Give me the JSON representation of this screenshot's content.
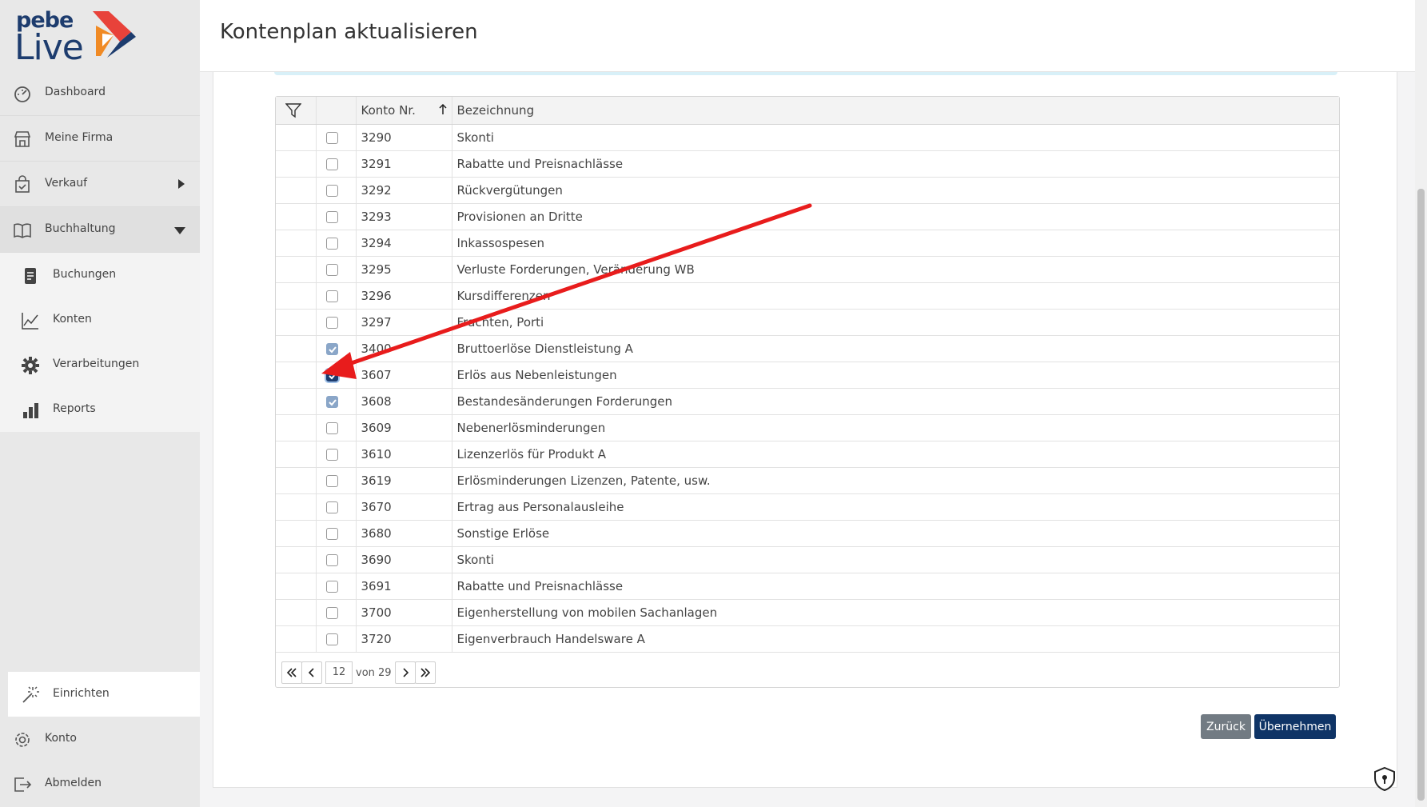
{
  "brand": {
    "top": "pebe",
    "bottom": "Live"
  },
  "header": {
    "title": "Kontenplan aktualisieren"
  },
  "sidebar": {
    "items": [
      {
        "label": "Dashboard",
        "icon": "dashboard-icon"
      },
      {
        "label": "Meine Firma",
        "icon": "store-icon"
      },
      {
        "label": "Verkauf",
        "icon": "shopping-bag-icon"
      },
      {
        "label": "Buchhaltung",
        "icon": "book-icon"
      }
    ],
    "subitems": [
      {
        "label": "Buchungen",
        "icon": "document-icon"
      },
      {
        "label": "Konten",
        "icon": "line-chart-icon"
      },
      {
        "label": "Verarbeitungen",
        "icon": "gear-icon"
      },
      {
        "label": "Reports",
        "icon": "bar-chart-icon"
      }
    ],
    "bottom": [
      {
        "label": "Einrichten",
        "icon": "magic-wand-icon"
      },
      {
        "label": "Konto",
        "icon": "settings-icon"
      },
      {
        "label": "Abmelden",
        "icon": "logout-icon"
      }
    ]
  },
  "grid": {
    "columns": {
      "konto_nr": "Konto Nr.",
      "bezeichnung": "Bezeichnung"
    },
    "rows": [
      {
        "nr": "3290",
        "name": "Skonti",
        "checked": false
      },
      {
        "nr": "3291",
        "name": "Rabatte und Preisnachlässe",
        "checked": false
      },
      {
        "nr": "3292",
        "name": "Rückvergütungen",
        "checked": false
      },
      {
        "nr": "3293",
        "name": "Provisionen an Dritte",
        "checked": false
      },
      {
        "nr": "3294",
        "name": "Inkassospesen",
        "checked": false
      },
      {
        "nr": "3295",
        "name": "Verluste Forderungen, Veränderung WB",
        "checked": false
      },
      {
        "nr": "3296",
        "name": "Kursdifferenzen",
        "checked": false
      },
      {
        "nr": "3297",
        "name": "Frachten, Porti",
        "checked": false
      },
      {
        "nr": "3400",
        "name": "Bruttoerlöse Dienstleistung A",
        "checked": true
      },
      {
        "nr": "3607",
        "name": "Erlös aus Nebenleistungen",
        "checked": true,
        "focused": true
      },
      {
        "nr": "3608",
        "name": "Bestandesänderungen Forderungen",
        "checked": true
      },
      {
        "nr": "3609",
        "name": "Nebenerlösminderungen",
        "checked": false
      },
      {
        "nr": "3610",
        "name": "Lizenzerlös für Produkt A",
        "checked": false
      },
      {
        "nr": "3619",
        "name": "Erlösminderungen Lizenzen, Patente, usw.",
        "checked": false
      },
      {
        "nr": "3670",
        "name": "Ertrag aus Personalausleihe",
        "checked": false
      },
      {
        "nr": "3680",
        "name": "Sonstige Erlöse",
        "checked": false
      },
      {
        "nr": "3690",
        "name": "Skonti",
        "checked": false
      },
      {
        "nr": "3691",
        "name": "Rabatte und Preisnachlässe",
        "checked": false
      },
      {
        "nr": "3700",
        "name": "Eigenherstellung von mobilen Sachanlagen",
        "checked": false
      },
      {
        "nr": "3720",
        "name": "Eigenverbrauch Handelsware A",
        "checked": false
      }
    ]
  },
  "pager": {
    "page": "12",
    "of_text": "von 29"
  },
  "actions": {
    "back": "Zurück",
    "apply": "Übernehmen"
  },
  "colors": {
    "brand_navy": "#1d3c6e",
    "brand_red": "#e8423a",
    "brand_orange": "#f08a24",
    "annotation_arrow": "#e81c1c"
  }
}
